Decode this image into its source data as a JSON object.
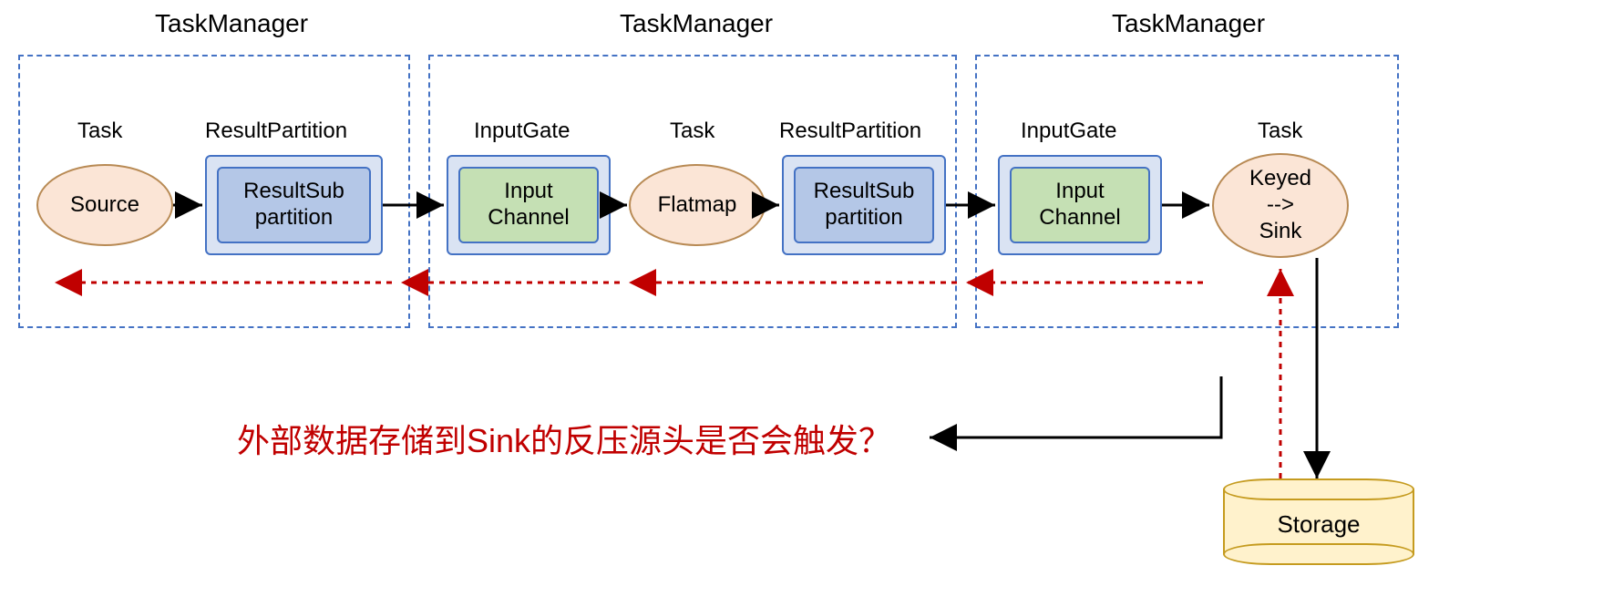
{
  "tm1": {
    "title": "TaskManager",
    "task_label": "Task",
    "rp_label": "ResultPartition",
    "source": "Source",
    "rsp": "ResultSub\npartition"
  },
  "tm2": {
    "title": "TaskManager",
    "ig_label": "InputGate",
    "task_label": "Task",
    "rp_label": "ResultPartition",
    "ic": "Input\nChannel",
    "flatmap": "Flatmap",
    "rsp": "ResultSub\npartition"
  },
  "tm3": {
    "title": "TaskManager",
    "ig_label": "InputGate",
    "task_label": "Task",
    "ic": "Input\nChannel",
    "sink": "Keyed\n-->\nSink"
  },
  "storage": "Storage",
  "question": "外部数据存储到Sink的反压源头是否会触发？"
}
